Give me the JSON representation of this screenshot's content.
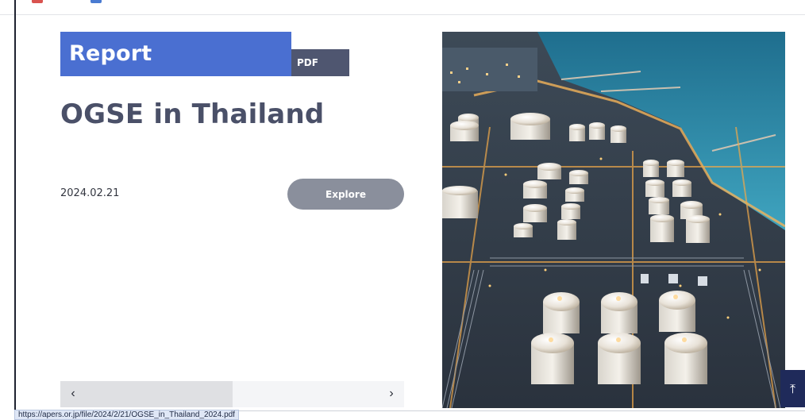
{
  "report": {
    "category_label": "Report",
    "format_tag": "PDF",
    "title": "OGSE in Thailand",
    "date": "2024.02.21",
    "explore_label": "Explore"
  },
  "slider": {
    "prev_symbol": "‹",
    "next_symbol": "›",
    "progress": 0.5
  },
  "status_bar": {
    "url": "https://apers.or.jp/file/2024/2/21/OGSE_in_Thailand_2024.pdf"
  },
  "photo": {
    "subject": "aerial view of oil and gas storage tank farm at a coastal port at dusk"
  },
  "back_to_top": {
    "symbol": "⤒"
  },
  "colors": {
    "banner_blue": "#4a6fd1",
    "tag_gray": "#4f5670",
    "title_slate": "#4a5068",
    "button_gray": "#8a8f9c",
    "back_top_navy": "#1f2a5a"
  }
}
